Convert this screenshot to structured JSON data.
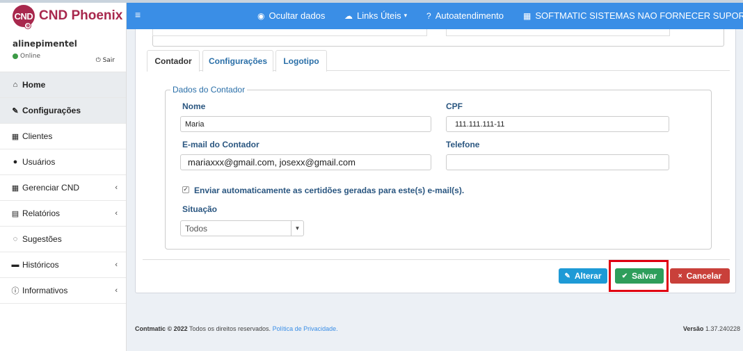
{
  "app": {
    "name": "CND Phoenix",
    "logo_text": "CND"
  },
  "user": {
    "name": "alinepimentel",
    "status": "Online",
    "logout": "Sair"
  },
  "sidebar": {
    "items": [
      {
        "label": "Home",
        "icon": "home-icon",
        "glyph": "🏠"
      },
      {
        "label": "Configurações",
        "icon": "wrench-icon",
        "glyph": "🔧"
      },
      {
        "label": "Clientes",
        "icon": "building-icon",
        "glyph": "▦"
      },
      {
        "label": "Usuários",
        "icon": "user-icon",
        "glyph": "👤"
      },
      {
        "label": "Gerenciar CND",
        "icon": "calendar-icon",
        "glyph": "▦"
      },
      {
        "label": "Relatórios",
        "icon": "file-icon",
        "glyph": "▤"
      },
      {
        "label": "Sugestões",
        "icon": "comments-icon",
        "glyph": "💬"
      },
      {
        "label": "Históricos",
        "icon": "archive-icon",
        "glyph": "▬"
      },
      {
        "label": "Informativos",
        "icon": "info-icon",
        "glyph": "ℹ"
      }
    ]
  },
  "topnav": {
    "hide_data": "Ocultar dados",
    "links": "Links Úteis",
    "self_service": "Autoatendimento",
    "company": "SOFTMATIC SISTEMAS NAO FORNECER SUPORTE"
  },
  "tabs": [
    "Contador",
    "Configurações",
    "Logotipo"
  ],
  "form": {
    "legend": "Dados do Contador",
    "nome_label": "Nome",
    "nome_value": "Maria",
    "cpf_label": "CPF",
    "cpf_value": "111.111.111-11",
    "email_label": "E-mail do Contador",
    "email_value": "mariaxxx@gmail.com, josexx@gmail.com",
    "telefone_label": "Telefone",
    "telefone_value": "",
    "auto_send_label": "Enviar automaticamente as certidões geradas para este(s) e-mail(s).",
    "auto_send_checked": true,
    "situacao_label": "Situação",
    "situacao_value": "Todos"
  },
  "buttons": {
    "alterar": "Alterar",
    "salvar": "Salvar",
    "cancelar": "Cancelar"
  },
  "colors": {
    "brand": "#a8284d",
    "nav": "#3a8ee6",
    "alterar": "#1e9ad6",
    "salvar": "#2e9e5b",
    "cancelar": "#c9403a",
    "highlight": "#e00010"
  },
  "footer": {
    "company": "Contmatic © 2022",
    "rights": "Todos os direitos reservados.",
    "privacy": "Política de Privacidade.",
    "version_label": "Versão",
    "version": "1.37.240228"
  }
}
